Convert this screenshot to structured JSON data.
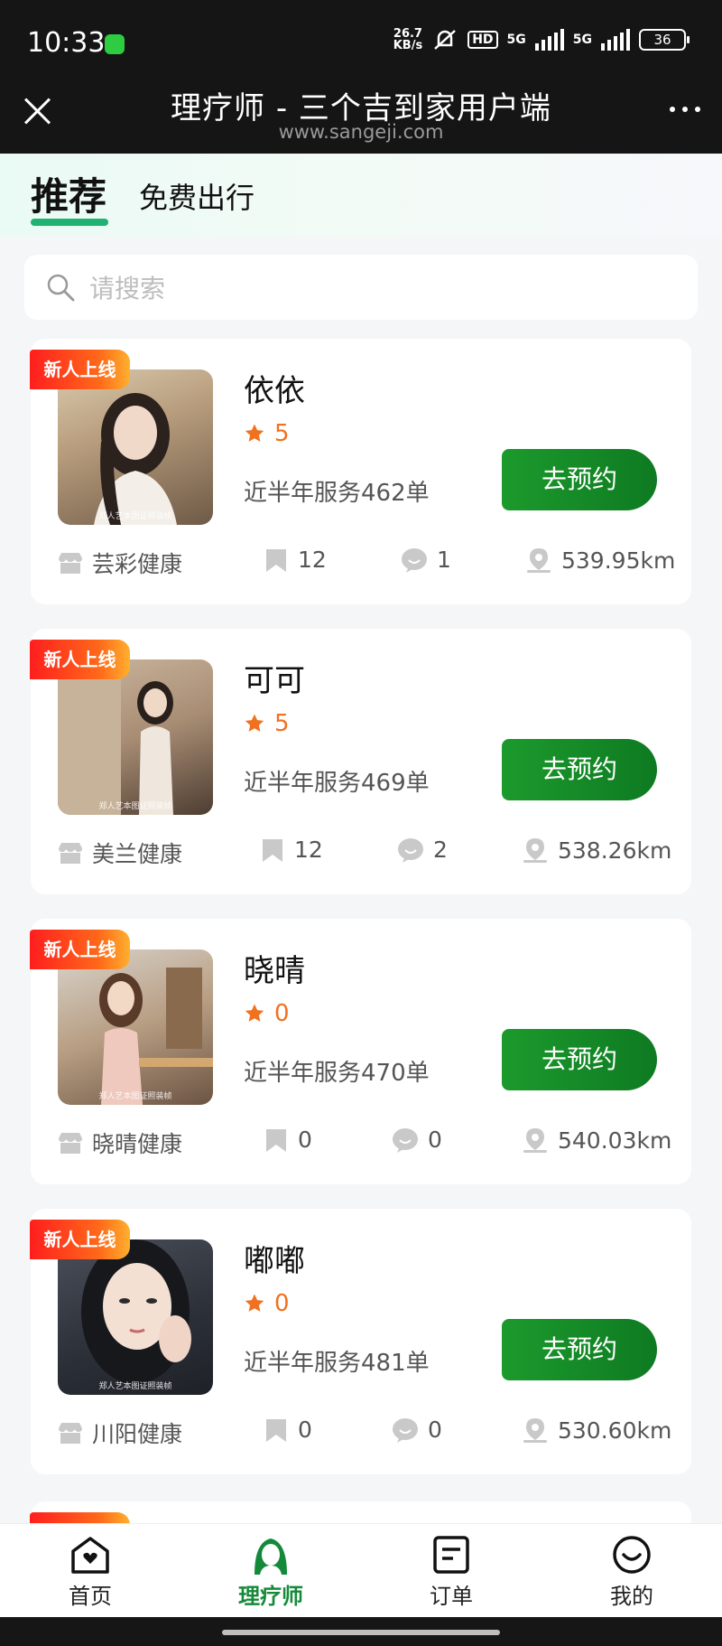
{
  "status_bar": {
    "time": "10:33",
    "network_speed_value": "26.7",
    "network_speed_unit": "KB/s",
    "hd": "HD",
    "signal1": "5G",
    "signal2": "5G",
    "battery": "36"
  },
  "title_bar": {
    "title": "理疗师 - 三个吉到家用户端",
    "url": "www.sangeji.com"
  },
  "tabs": [
    {
      "label": "推荐",
      "active": true
    },
    {
      "label": "免费出行",
      "active": false
    }
  ],
  "search": {
    "placeholder": "请搜索"
  },
  "book_label": "去预约",
  "new_badge": "新人上线",
  "photo_caption": "郑人艺本图证照装帧",
  "therapists": [
    {
      "name": "依依",
      "rating": "5",
      "orders": "近半年服务462单",
      "shop": "芸彩健康",
      "favorites": "12",
      "comments": "1",
      "distance": "539.95km"
    },
    {
      "name": "可可",
      "rating": "5",
      "orders": "近半年服务469单",
      "shop": "美兰健康",
      "favorites": "12",
      "comments": "2",
      "distance": "538.26km"
    },
    {
      "name": "晓晴",
      "rating": "0",
      "orders": "近半年服务470单",
      "shop": "晓晴健康",
      "favorites": "0",
      "comments": "0",
      "distance": "540.03km"
    },
    {
      "name": "嘟嘟",
      "rating": "0",
      "orders": "近半年服务481单",
      "shop": "川阳健康",
      "favorites": "0",
      "comments": "0",
      "distance": "530.60km"
    }
  ],
  "bottom_nav": [
    {
      "label": "首页",
      "icon": "home-icon",
      "active": false
    },
    {
      "label": "理疗师",
      "icon": "therapist-icon",
      "active": true
    },
    {
      "label": "订单",
      "icon": "order-icon",
      "active": false
    },
    {
      "label": "我的",
      "icon": "profile-icon",
      "active": false
    }
  ],
  "colors": {
    "accent_green": "#168a3a",
    "button_green": "#1c9a2c",
    "rating_orange": "#f0711f",
    "badge_red": "#ff1e1e"
  }
}
